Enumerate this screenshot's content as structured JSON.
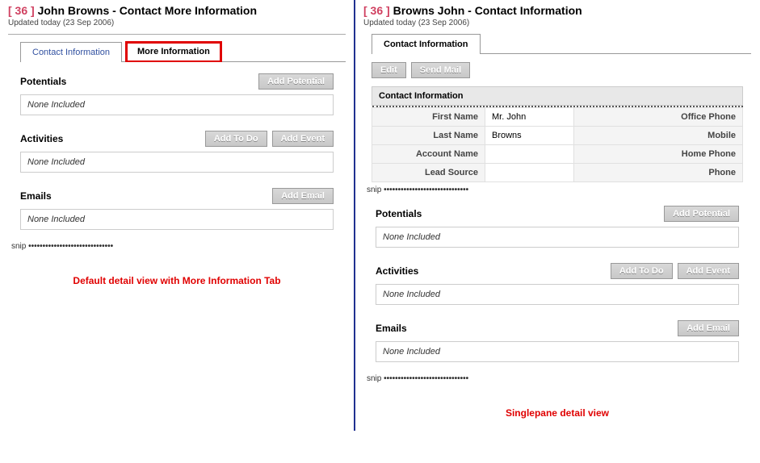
{
  "left": {
    "id_text": "[ 36 ]",
    "title": "John Browns - Contact More Information",
    "updated": "Updated today (23 Sep 2006)",
    "tabs": {
      "contact_info": "Contact Information",
      "more_info": "More Information"
    },
    "sections": {
      "potentials": {
        "title": "Potentials",
        "btn": "Add Potential",
        "empty": "None Included"
      },
      "activities": {
        "title": "Activities",
        "btn1": "Add To Do",
        "btn2": "Add Event",
        "empty": "None Included"
      },
      "emails": {
        "title": "Emails",
        "btn": "Add Email",
        "empty": "None Included"
      }
    },
    "snip": "snip",
    "caption": "Default detail view with More Information Tab"
  },
  "right": {
    "id_text": "[ 36 ]",
    "title": "Browns John - Contact Information",
    "updated": "Updated today (23 Sep 2006)",
    "tabs": {
      "contact_info": "Contact Information"
    },
    "actions": {
      "edit": "Edit",
      "send_mail": "Send Mail"
    },
    "info_group": "Contact Information",
    "fields": {
      "first_name": {
        "label": "First Name",
        "value": "Mr. John"
      },
      "last_name": {
        "label": "Last Name",
        "value": "Browns"
      },
      "account_name": {
        "label": "Account Name",
        "value": ""
      },
      "lead_source": {
        "label": "Lead Source",
        "value": ""
      },
      "office_phone": {
        "label": "Office Phone"
      },
      "mobile": {
        "label": "Mobile"
      },
      "home_phone": {
        "label": "Home Phone"
      },
      "phone": {
        "label": "Phone"
      }
    },
    "sections": {
      "potentials": {
        "title": "Potentials",
        "btn": "Add Potential",
        "empty": "None Included"
      },
      "activities": {
        "title": "Activities",
        "btn1": "Add To Do",
        "btn2": "Add Event",
        "empty": "None Included"
      },
      "emails": {
        "title": "Emails",
        "btn": "Add Email",
        "empty": "None Included"
      }
    },
    "snip": "snip",
    "caption": "Singlepane detail view"
  }
}
